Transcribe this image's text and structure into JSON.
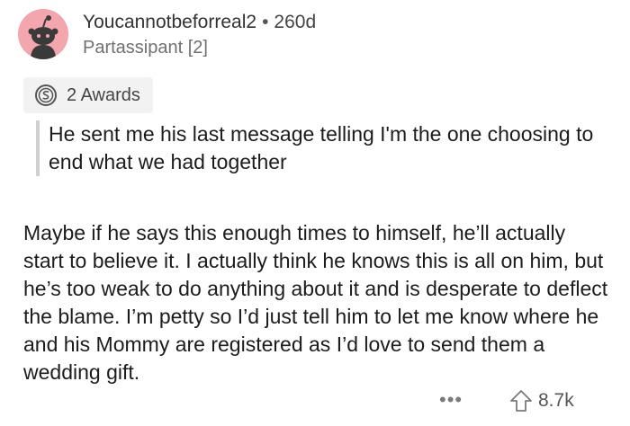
{
  "comment": {
    "author": "Youcannotbeforreal2",
    "separator": "•",
    "age": "260d",
    "flair": "Partassipant [2]",
    "awards_label": "2 Awards",
    "quote": "He sent me his last message telling I'm the one choosing to end what we had together",
    "body": "Maybe if he says this enough times to himself, he’ll actually start to believe it. I actually think he knows this is all on him, but he’s too weak to do anything about it and is desperate to deflect the blame. I’m petty so I’d just tell him to let me know where he and his Mommy are registered as I’d love to send them a wedding gift.",
    "more_label": "•••",
    "score": "8.7k"
  },
  "colors": {
    "avatar_bg": "#f4a6ae",
    "quote_bar": "#d0d0d0",
    "awards_bg": "#f2f2f2"
  },
  "icons": {
    "avatar": "snoo-avatar-icon",
    "award": "silver-award-icon",
    "upvote": "upvote-arrow-icon"
  }
}
